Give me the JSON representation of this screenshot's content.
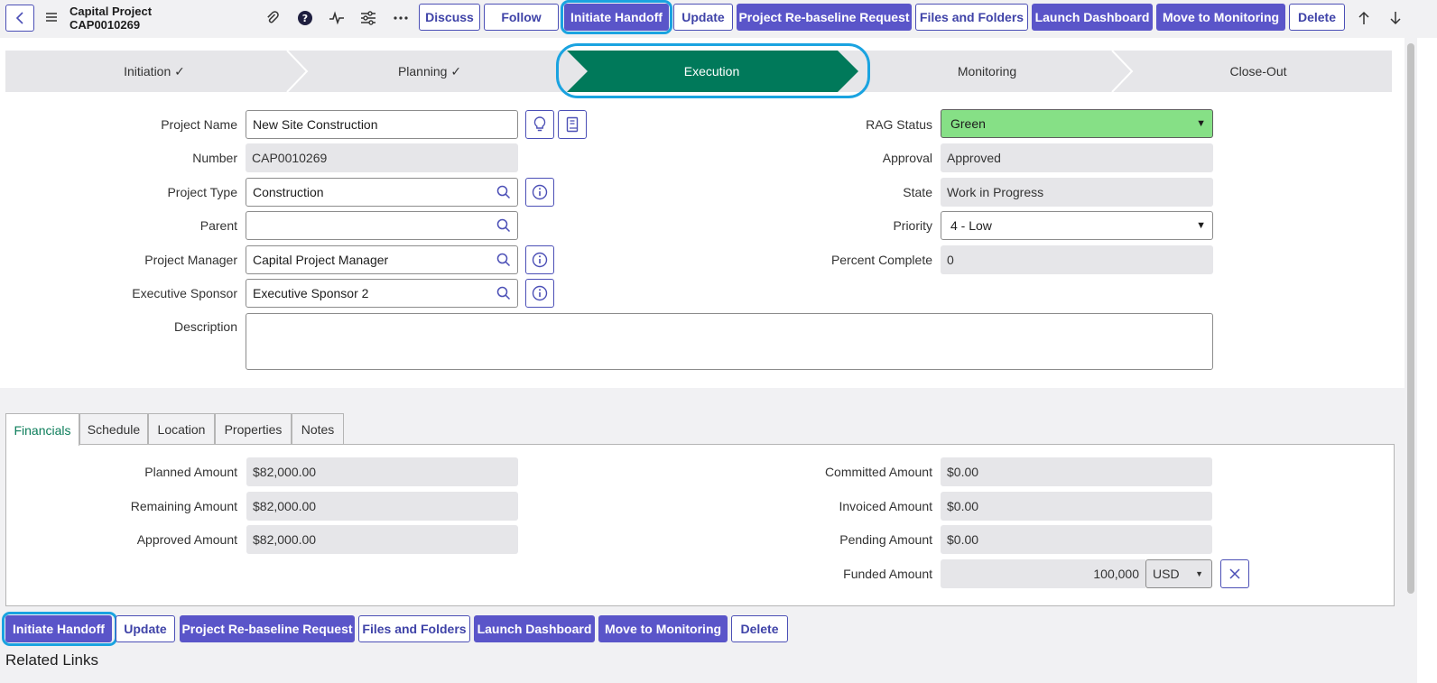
{
  "header": {
    "title": "Capital Project",
    "number": "CAP0010269",
    "buttons": {
      "discuss": "Discuss",
      "follow": "Follow",
      "initiate_handoff": "Initiate Handoff",
      "update": "Update",
      "rebaseline": "Project Re-baseline Request",
      "files_folders": "Files and Folders",
      "launch_dashboard": "Launch Dashboard",
      "move_monitoring": "Move to Monitoring",
      "delete": "Delete"
    }
  },
  "stages": [
    {
      "label": "Initiation ✓",
      "state": "complete"
    },
    {
      "label": "Planning ✓",
      "state": "complete"
    },
    {
      "label": "Execution",
      "state": "active"
    },
    {
      "label": "Monitoring",
      "state": "pending"
    },
    {
      "label": "Close-Out",
      "state": "pending"
    }
  ],
  "form": {
    "project_name": {
      "label": "Project Name",
      "value": "New Site Construction"
    },
    "number": {
      "label": "Number",
      "value": "CAP0010269"
    },
    "project_type": {
      "label": "Project Type",
      "value": "Construction"
    },
    "parent": {
      "label": "Parent",
      "value": ""
    },
    "project_manager": {
      "label": "Project Manager",
      "value": "Capital Project Manager"
    },
    "executive_sponsor": {
      "label": "Executive Sponsor",
      "value": "Executive Sponsor 2"
    },
    "description": {
      "label": "Description",
      "value": ""
    },
    "rag_status": {
      "label": "RAG Status",
      "value": "Green"
    },
    "approval": {
      "label": "Approval",
      "value": "Approved"
    },
    "state": {
      "label": "State",
      "value": "Work in Progress"
    },
    "priority": {
      "label": "Priority",
      "value": "4 - Low"
    },
    "percent_complete": {
      "label": "Percent Complete",
      "value": "0"
    }
  },
  "tabs": [
    "Financials",
    "Schedule",
    "Location",
    "Properties",
    "Notes"
  ],
  "financials": {
    "planned_amount": {
      "label": "Planned Amount",
      "value": "$82,000.00"
    },
    "remaining_amount": {
      "label": "Remaining Amount",
      "value": "$82,000.00"
    },
    "approved_amount": {
      "label": "Approved Amount",
      "value": "$82,000.00"
    },
    "committed_amount": {
      "label": "Committed Amount",
      "value": "$0.00"
    },
    "invoiced_amount": {
      "label": "Invoiced Amount",
      "value": "$0.00"
    },
    "pending_amount": {
      "label": "Pending Amount",
      "value": "$0.00"
    },
    "funded_amount": {
      "label": "Funded Amount",
      "value": "100,000",
      "currency": "USD"
    }
  },
  "related_links": "Related Links",
  "colors": {
    "primary": "#5a55c9",
    "active_stage": "#00795a",
    "rag_green": "#86e086",
    "focus_ring": "#1aa3e0"
  }
}
